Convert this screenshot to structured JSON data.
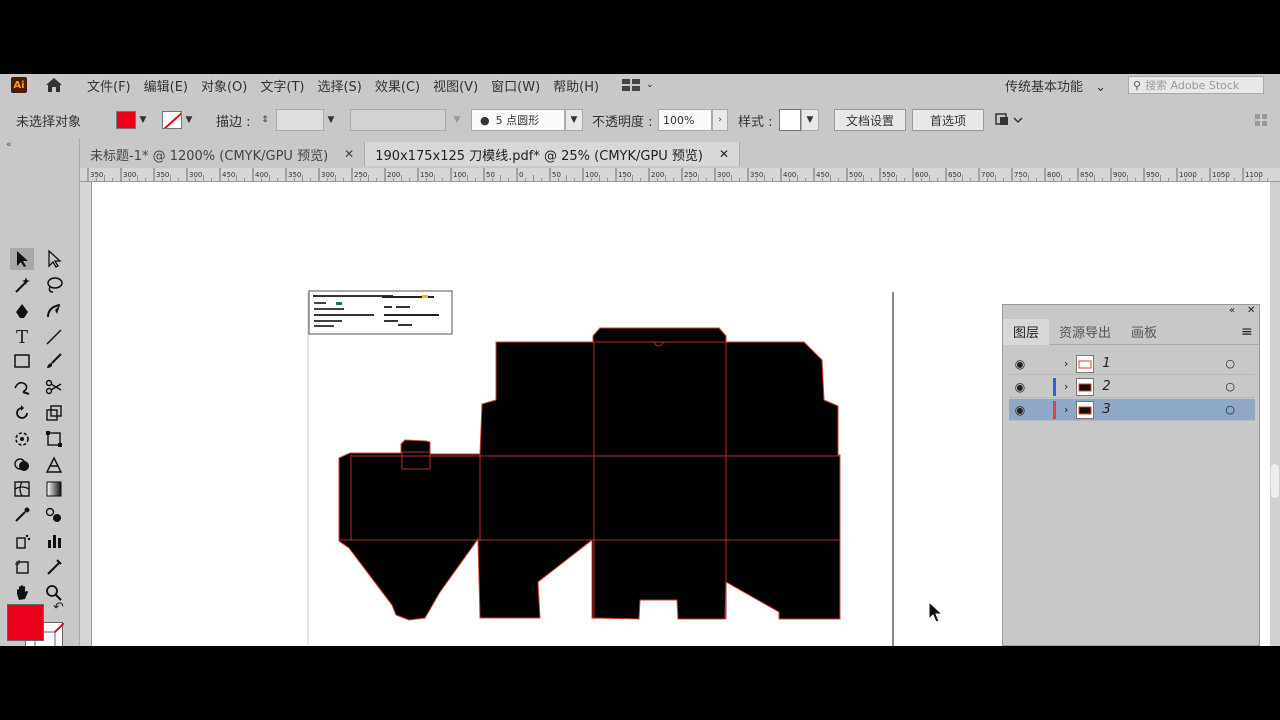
{
  "menubar": {
    "logo": "Ai",
    "items": [
      "文件(F)",
      "编辑(E)",
      "对象(O)",
      "文字(T)",
      "选择(S)",
      "效果(C)",
      "视图(V)",
      "窗口(W)",
      "帮助(H)"
    ],
    "workspace": "传统基本功能",
    "search_placeholder": "搜索 Adobe Stock"
  },
  "controlbar": {
    "selection_label": "未选择对象",
    "fill_color": "#e8001c",
    "stroke_label": "描边 :",
    "brush_label": "5 点圆形",
    "opacity_label": "不透明度 :",
    "opacity_value": "100%",
    "style_label": "样式 :",
    "doc_setup": "文档设置",
    "preferences": "首选项"
  },
  "tabs": [
    {
      "label": "未标题-1* @ 1200% (CMYK/GPU 预览)",
      "active": false
    },
    {
      "label": "190x175x125 刀模线.pdf* @ 25% (CMYK/GPU 预览)",
      "active": true
    }
  ],
  "ruler": {
    "labels": [
      "350",
      "300",
      "350",
      "300",
      "450",
      "400",
      "350",
      "300",
      "250",
      "200",
      "150",
      "100",
      "50",
      "0",
      "50",
      "100",
      "150",
      "200",
      "250",
      "300",
      "350",
      "400",
      "450",
      "500",
      "550",
      "600",
      "650",
      "700",
      "750",
      "800",
      "850",
      "900",
      "950",
      "1000",
      "1050",
      "1100"
    ]
  },
  "layers_panel": {
    "tabs": [
      "图层",
      "资源导出",
      "画板"
    ],
    "layers": [
      {
        "name": "1",
        "color": "#e04040",
        "selected": false
      },
      {
        "name": "2",
        "color": "#3060e0",
        "selected": false
      },
      {
        "name": "3",
        "color": "#e04040",
        "selected": true
      }
    ]
  },
  "colors": {
    "fill": "#e8001c",
    "dieline": "#d04030",
    "ui_bg": "#c8c8c8",
    "selection": "#8fa8c8"
  }
}
